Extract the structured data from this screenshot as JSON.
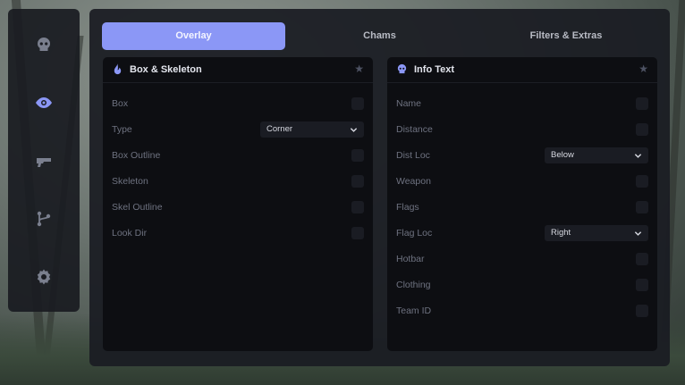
{
  "tabs": [
    {
      "label": "Overlay",
      "active": true
    },
    {
      "label": "Chams",
      "active": false
    },
    {
      "label": "Filters & Extras",
      "active": false
    }
  ],
  "sidebar": {
    "icons": [
      "skull-icon",
      "eye-icon",
      "gun-icon",
      "branch-icon",
      "gear-icon"
    ]
  },
  "box_skeleton": {
    "title": "Box & Skeleton",
    "icon": "flame-icon",
    "rows": {
      "box": "Box",
      "type": "Type",
      "type_value": "Corner",
      "box_outline": "Box Outline",
      "skeleton": "Skeleton",
      "skel_outline": "Skel Outline",
      "look_dir": "Look Dir"
    }
  },
  "info_text": {
    "title": "Info Text",
    "icon": "skull-icon",
    "rows": {
      "name": "Name",
      "distance": "Distance",
      "dist_loc": "Dist Loc",
      "dist_loc_value": "Below",
      "weapon": "Weapon",
      "flags": "Flags",
      "flag_loc": "Flag Loc",
      "flag_loc_value": "Right",
      "hotbar": "Hotbar",
      "clothing": "Clothing",
      "team_id": "Team ID"
    }
  },
  "colors": {
    "accent": "#8b97f6",
    "panel": "#1a1c22",
    "card": "#0d0e12",
    "muted_text": "#6e7280"
  }
}
